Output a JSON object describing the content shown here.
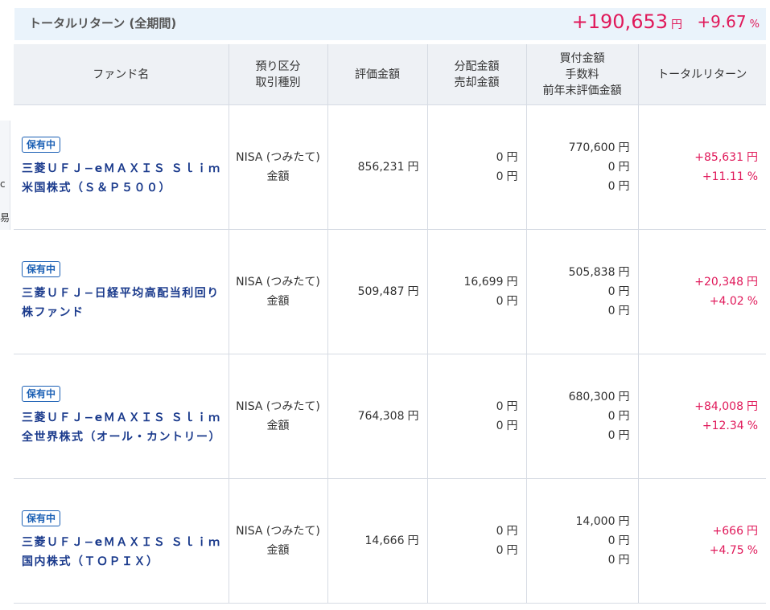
{
  "left_fragment": [
    "c",
    "易"
  ],
  "summary": {
    "label": "トータルリターン (全期間)",
    "amount": "+190,653",
    "amount_unit": "円",
    "percent": "+9.67",
    "percent_unit": "%"
  },
  "table": {
    "headers": {
      "fund_name": "ファンド名",
      "category_1": "預り区分",
      "category_2": "取引種別",
      "valuation": "評価金額",
      "dist_1": "分配金額",
      "dist_2": "売却金額",
      "buy_1": "買付金額",
      "buy_2": "手数料",
      "buy_3": "前年末評価金額",
      "total_return": "トータルリターン"
    },
    "yen": "円",
    "pct": "%",
    "rows": [
      {
        "badge": "保有中",
        "name": "三菱ＵＦＪ−eＭＡＸＩＳ Ｓｌｉｍ 米国株式（Ｓ＆Ｐ５００）",
        "account": "NISA (つみたて)",
        "trade_type": "金額",
        "valuation": "856,231",
        "distribution": "0",
        "sale": "0",
        "purchase": "770,600",
        "fee": "0",
        "prev_year_val": "0",
        "return_amount": "+85,631",
        "return_pct": "+11.11"
      },
      {
        "badge": "保有中",
        "name": "三菱ＵＦＪ−日経平均高配当利回り株ファンド",
        "account": "NISA (つみたて)",
        "trade_type": "金額",
        "valuation": "509,487",
        "distribution": "16,699",
        "sale": "0",
        "purchase": "505,838",
        "fee": "0",
        "prev_year_val": "0",
        "return_amount": "+20,348",
        "return_pct": "+4.02"
      },
      {
        "badge": "保有中",
        "name": "三菱ＵＦＪ−eＭＡＸＩＳ Ｓｌｉｍ 全世界株式（オール・カントリー）",
        "account": "NISA (つみたて)",
        "trade_type": "金額",
        "valuation": "764,308",
        "distribution": "0",
        "sale": "0",
        "purchase": "680,300",
        "fee": "0",
        "prev_year_val": "0",
        "return_amount": "+84,008",
        "return_pct": "+12.34"
      },
      {
        "badge": "保有中",
        "name": "三菱ＵＦＪ−eＭＡＸＩＳ Ｓｌｉｍ 国内株式（ＴＯＰＩＸ）",
        "account": "NISA (つみたて)",
        "trade_type": "金額",
        "valuation": "14,666",
        "distribution": "0",
        "sale": "0",
        "purchase": "14,000",
        "fee": "0",
        "prev_year_val": "0",
        "return_amount": "+666",
        "return_pct": "+4.75"
      }
    ]
  }
}
